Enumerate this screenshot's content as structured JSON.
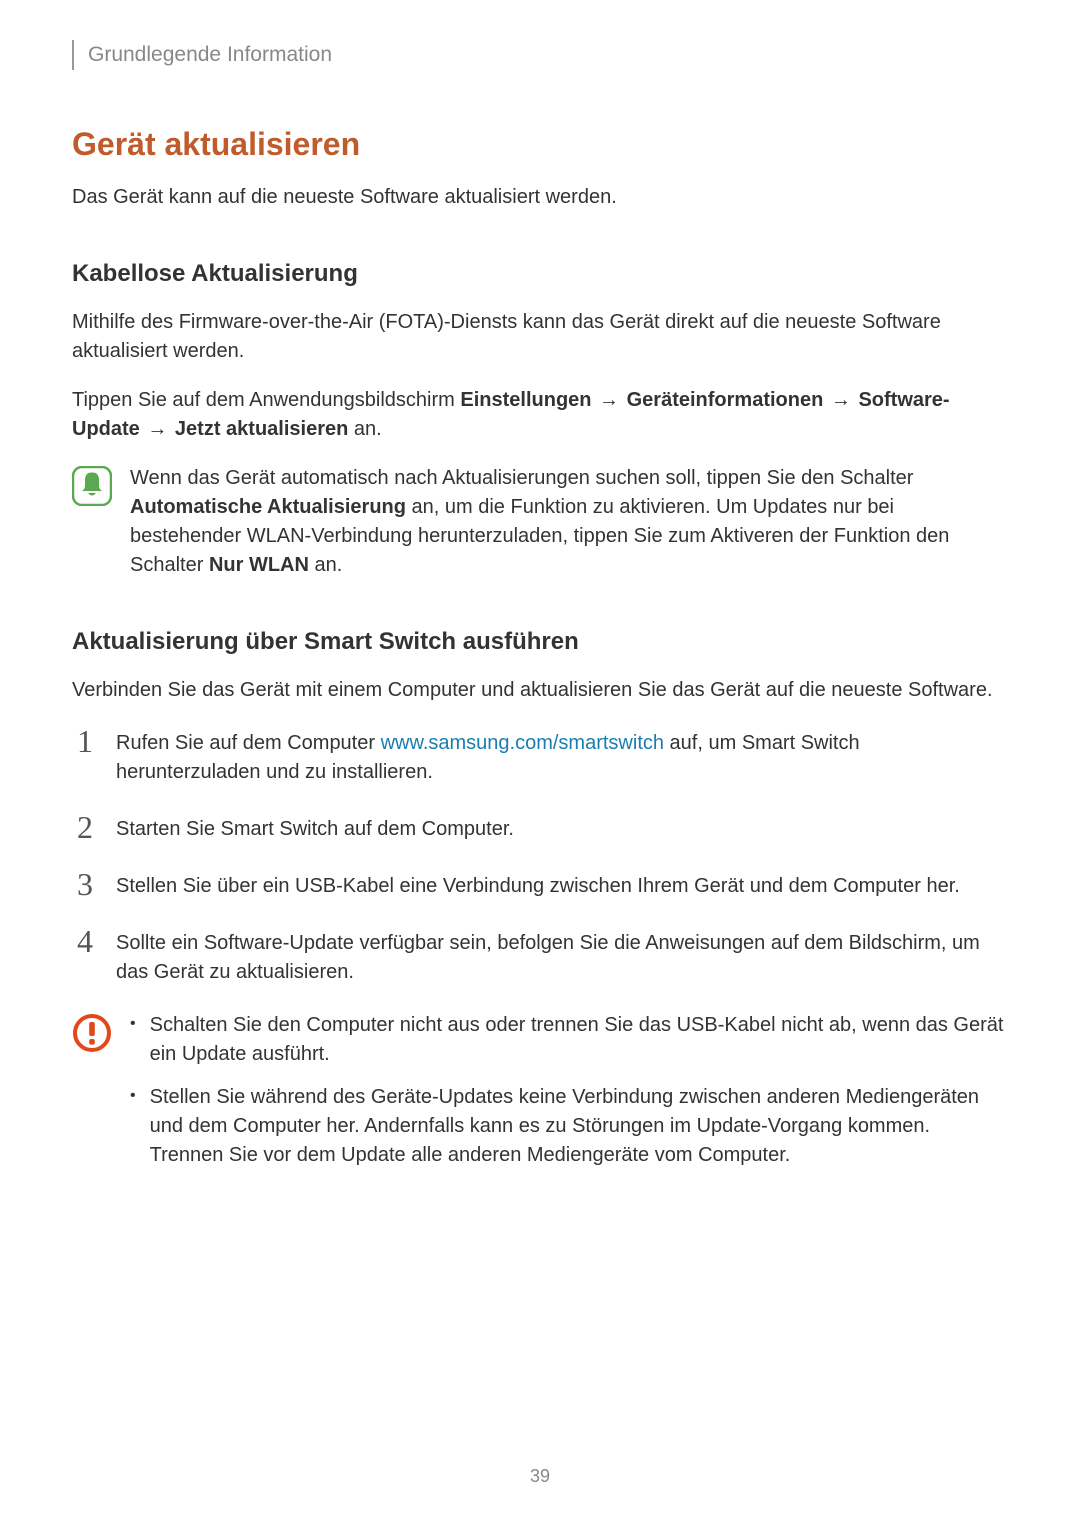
{
  "breadcrumb": "Grundlegende Information",
  "h1": "Gerät aktualisieren",
  "intro": "Das Gerät kann auf die neueste Software aktualisiert werden.",
  "sub1": "Kabellose Aktualisierung",
  "sub1_p1": "Mithilfe des Firmware-over-the-Air (FOTA)-Diensts kann das Gerät direkt auf die neueste Software aktualisiert werden.",
  "path": {
    "prefix": "Tippen Sie auf dem Anwendungsbildschirm ",
    "b1": "Einstellungen",
    "arrow": " → ",
    "b2": "Geräteinformationen",
    "b3": "Software-Update",
    "b4": "Jetzt aktualisieren",
    "suffix": " an."
  },
  "note": {
    "t1": "Wenn das Gerät automatisch nach Aktualisierungen suchen soll, tippen Sie den Schalter ",
    "b1": "Automatische Aktualisierung",
    "t2": " an, um die Funktion zu aktivieren. Um Updates nur bei bestehender WLAN-Verbindung herunterzuladen, tippen Sie zum Aktiveren der Funktion den Schalter ",
    "b2": "Nur WLAN",
    "t3": " an."
  },
  "sub2": "Aktualisierung über Smart Switch ausführen",
  "sub2_p1": "Verbinden Sie das Gerät mit einem Computer und aktualisieren Sie das Gerät auf die neueste Software.",
  "steps": {
    "n1": "1",
    "s1a": "Rufen Sie auf dem Computer ",
    "s1link": "www.samsung.com/smartswitch",
    "s1b": " auf, um Smart Switch herunterzuladen und zu installieren.",
    "n2": "2",
    "s2": "Starten Sie Smart Switch auf dem Computer.",
    "n3": "3",
    "s3": "Stellen Sie über ein USB-Kabel eine Verbindung zwischen Ihrem Gerät und dem Computer her.",
    "n4": "4",
    "s4": "Sollte ein Software-Update verfügbar sein, befolgen Sie die Anweisungen auf dem Bildschirm, um das Gerät zu aktualisieren."
  },
  "warn": {
    "b1": "Schalten Sie den Computer nicht aus oder trennen Sie das USB-Kabel nicht ab, wenn das Gerät ein Update ausführt.",
    "b2": "Stellen Sie während des Geräte-Updates keine Verbindung zwischen anderen Mediengeräten und dem Computer her. Andernfalls kann es zu Störungen im Update-Vorgang kommen. Trennen Sie vor dem Update alle anderen Mediengeräte vom Computer."
  },
  "page_number": "39"
}
